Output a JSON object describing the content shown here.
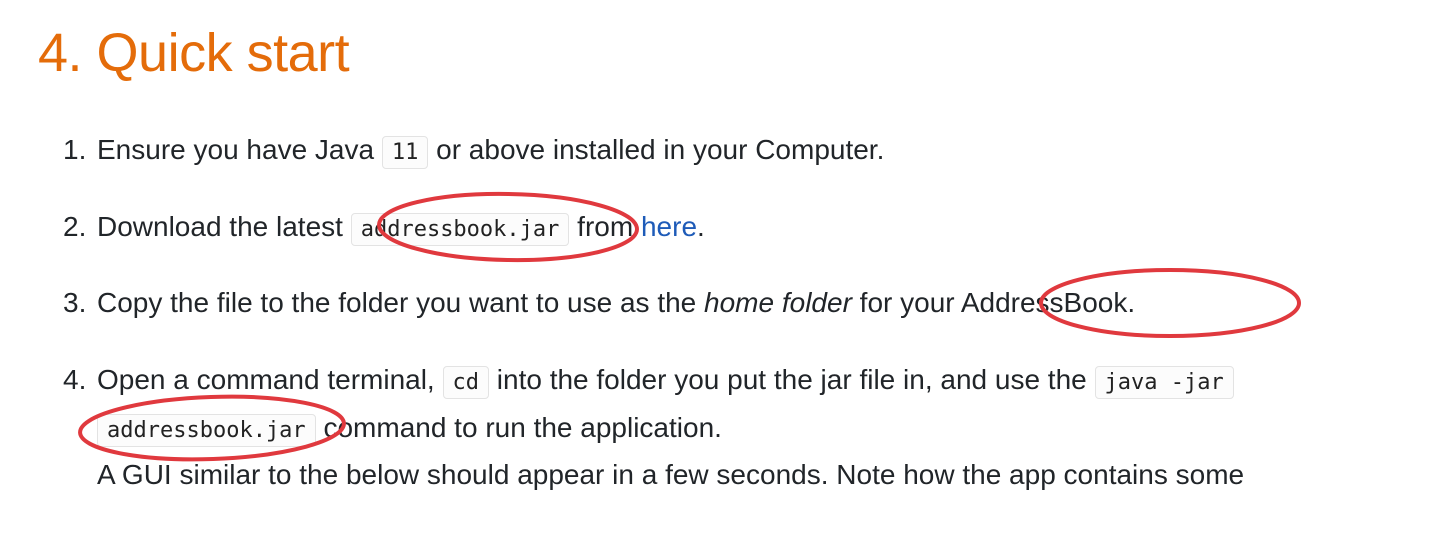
{
  "heading": "4. Quick start",
  "steps": [
    {
      "num": "1.",
      "t1": "Ensure you have Java ",
      "code1": "11",
      "t2": " or above installed in your Computer."
    },
    {
      "num": "2.",
      "t1": "Download the latest ",
      "code1": "addressbook.jar",
      "t2": " from ",
      "link": "here",
      "t3": "."
    },
    {
      "num": "3.",
      "t1": "Copy the file to the folder you want to use as the ",
      "em": "home folder",
      "t2": " for your AddressBook."
    },
    {
      "num": "4.",
      "t1": "Open a command terminal, ",
      "code1": "cd",
      "t2": " into the folder you put the jar file in, and use the ",
      "code2": "java -jar",
      "code3": "addressbook.jar",
      "t3": " command to run the application.",
      "t4": "A GUI similar to the below should appear in a few seconds. Note how the app contains some"
    }
  ],
  "annotation_color": "#e0393e"
}
